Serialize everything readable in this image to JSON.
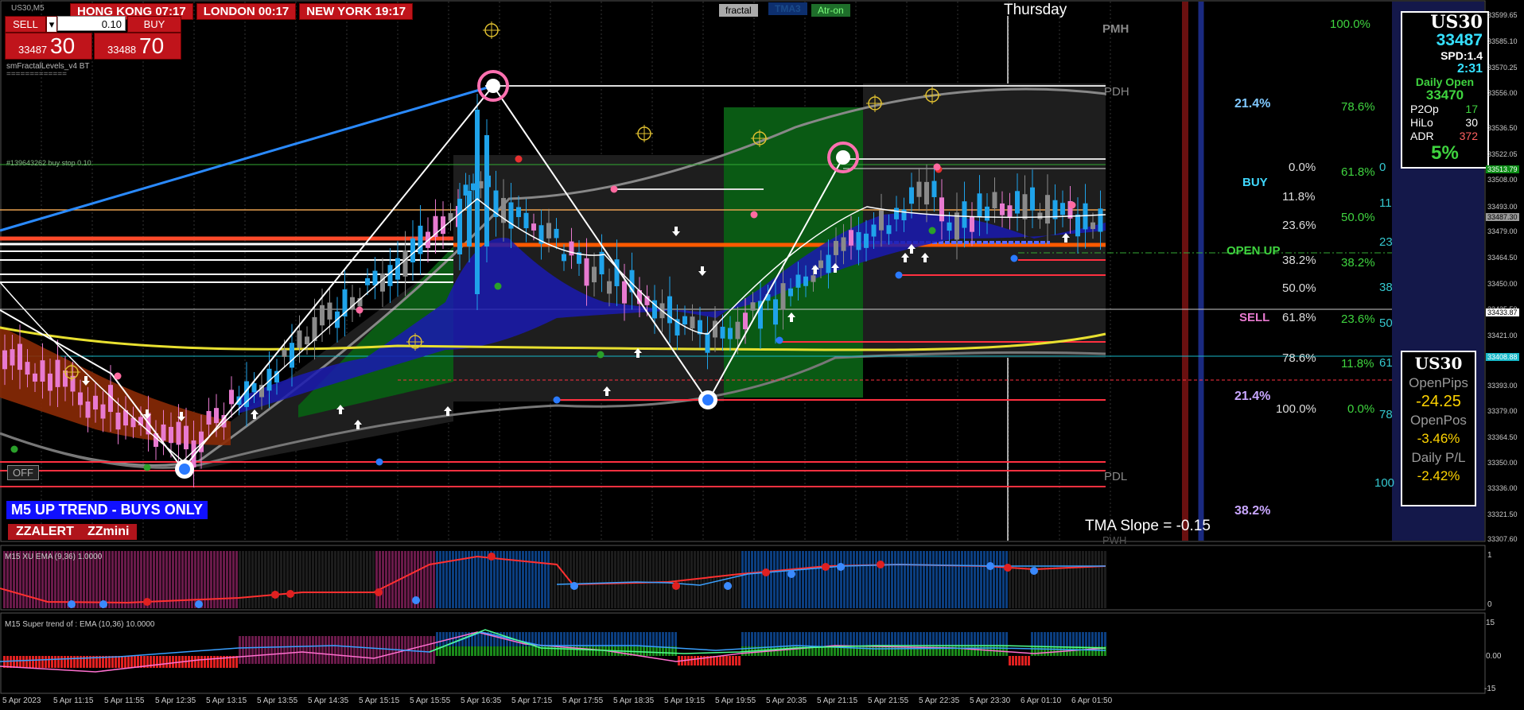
{
  "window": {
    "symbol_tab": "US30,M5"
  },
  "clocks": [
    {
      "city": "HONG KONG",
      "time": "07:17"
    },
    {
      "city": "LONDON",
      "time": "00:17"
    },
    {
      "city": "NEW YORK",
      "time": "19:17"
    }
  ],
  "trade_panel": {
    "sell_label": "SELL",
    "buy_label": "BUY",
    "lot": "0.10",
    "bid_prefix": "33487",
    "bid_big": "30",
    "ask_prefix": "33488",
    "ask_big": "70"
  },
  "indicators": {
    "fractal_name": "smFractalLevels_v4 BT",
    "fractal_dashes": "=============",
    "order_line": "#139643262 buy stop 0.10",
    "toggles": [
      "fractal",
      "TMA3",
      "Atr-on"
    ],
    "day_label": "Thursday",
    "off_button": "OFF",
    "pmh": "PMH",
    "pdh": "PDH",
    "pdl": "PDL",
    "pwh": "PWH",
    "trend_banner": "M5 UP TREND - BUYS ONLY",
    "zzalert": "ZZALERT",
    "zzmini": "ZZmini",
    "tma_slope": "TMA Slope = -0.15"
  },
  "fib_labels": {
    "pct_214_top": "21.4%",
    "buy": "BUY",
    "open_up": "OPEN UP",
    "sell": "SELL",
    "pct_214_low": "21.4%",
    "pct_382_low": "38.2%",
    "left_levels": [
      "0.0%",
      "11.8%",
      "23.6%",
      "38.2%",
      "50.0%",
      "61.8%",
      "78.6%",
      "100.0%"
    ],
    "right_levels": [
      "100.0%",
      "78.6%",
      "61.8%",
      "50.0%",
      "38.2%",
      "23.6%",
      "11.8%",
      "0.0%"
    ],
    "edge_levels": [
      "0",
      "11",
      "23",
      "38",
      "50",
      "61",
      "78",
      "100"
    ]
  },
  "info_panel": {
    "symbol": "US30",
    "price": "33487",
    "spd": "SPD:1.4",
    "timer": "2:31",
    "daily_open_label": "Daily Open",
    "daily_open": "33470",
    "rows": [
      {
        "label": "P2Op",
        "value": "17",
        "color": "#3fd43f"
      },
      {
        "label": "HiLo",
        "value": "30",
        "color": "#ffffff"
      },
      {
        "label": "ADR",
        "value": "372",
        "color": "#ff6060"
      }
    ],
    "pct": "5%"
  },
  "pos_panel": {
    "symbol": "US30",
    "open_pips_label": "OpenPips",
    "open_pips": "-24.25",
    "open_pos_label": "OpenPos",
    "open_pos": "-3.46%",
    "daily_pl_label": "Daily P/L",
    "daily_pl": "-2.42%"
  },
  "price_axis": [
    "33599.65",
    "33585.10",
    "33570.25",
    "33556.00",
    "33536.50",
    "33522.05",
    "33513.79",
    "33508.00",
    "33493.00",
    "33487.30",
    "33479.00",
    "33464.50",
    "33450.00",
    "33435.50",
    "33433.87",
    "33421.00",
    "33408.88",
    "33393.00",
    "33379.00",
    "33364.50",
    "33350.00",
    "33336.00",
    "33321.50",
    "33307.60"
  ],
  "price_axis_highlights": {
    "green": "33513.79",
    "current": "33487.30",
    "white": "33433.87",
    "cyan": "33408.88"
  },
  "subwindow1": {
    "label": "M15 XU EMA (9,36) 1.0000",
    "axis": [
      "1",
      "0"
    ]
  },
  "subwindow2": {
    "label": "M15  Super trend of : EMA (10,36)  10.0000",
    "axis": [
      "15",
      "0.00",
      "-15"
    ]
  },
  "time_axis": [
    "5 Apr 2023",
    "5 Apr 11:15",
    "5 Apr 11:55",
    "5 Apr 12:35",
    "5 Apr 13:15",
    "5 Apr 13:55",
    "5 Apr 14:35",
    "5 Apr 15:15",
    "5 Apr 15:55",
    "5 Apr 16:35",
    "5 Apr 17:15",
    "5 Apr 17:55",
    "5 Apr 18:35",
    "5 Apr 19:15",
    "5 Apr 19:55",
    "5 Apr 20:35",
    "5 Apr 21:15",
    "5 Apr 21:55",
    "5 Apr 22:35",
    "5 Apr 23:30",
    "6 Apr 01:10",
    "6 Apr 01:50"
  ],
  "colors": {
    "bull": "#1fa3ea",
    "bear": "#e87ad0",
    "tma_fill": "#1a1ab0",
    "red_cloud": "#8a2a05",
    "green_zone": "#0a5a14",
    "gray_zone": "#1e1e1e"
  }
}
